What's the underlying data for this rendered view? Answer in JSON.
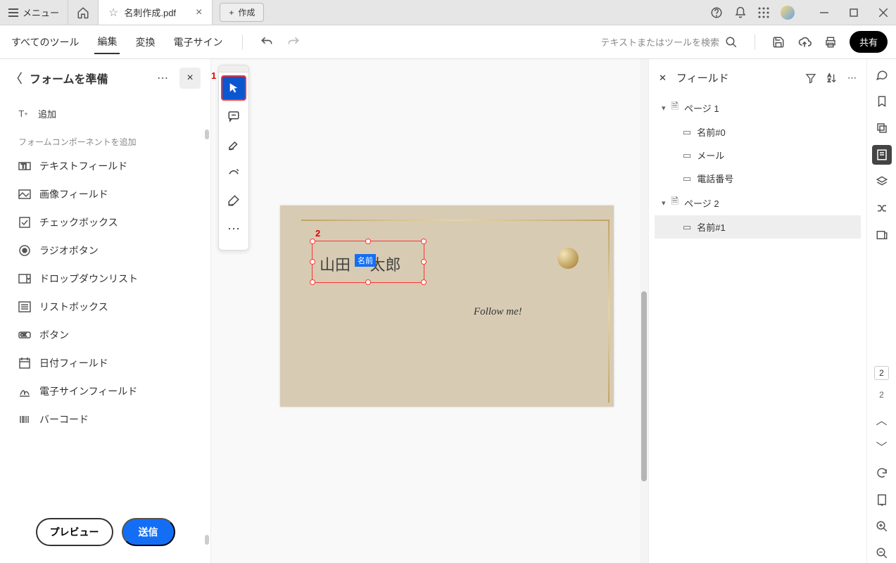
{
  "titlebar": {
    "menu_label": "メニュー",
    "tab_title": "名刺作成.pdf",
    "create_label": "作成"
  },
  "toolbar": {
    "all_tools": "すべてのツール",
    "edit": "編集",
    "convert": "変換",
    "esign": "電子サイン",
    "search_placeholder": "テキストまたはツールを検索",
    "share": "共有"
  },
  "left_panel": {
    "title": "フォームを準備",
    "add_label": "追加",
    "section_header": "フォームコンポーネントを追加",
    "items": [
      "テキストフィールド",
      "画像フィールド",
      "チェックボックス",
      "ラジオボタン",
      "ドロップダウンリスト",
      "リストボックス",
      "ボタン",
      "日付フィールド",
      "電子サインフィールド",
      "バーコード"
    ],
    "preview_btn": "プレビュー",
    "submit_btn": "送信"
  },
  "annotations": {
    "num1": "1",
    "num2": "2"
  },
  "page_content": {
    "field_text": "山田 　太郎",
    "field_label": "名前",
    "follow_text": "Follow me!"
  },
  "right_panel": {
    "title": "フィールド",
    "pages": [
      {
        "label": "ページ 1",
        "fields": [
          "名前#0",
          "メール",
          "電話番号"
        ]
      },
      {
        "label": "ページ 2",
        "fields": [
          "名前#1"
        ]
      }
    ],
    "selected_field": "名前#1"
  },
  "right_rail": {
    "page_box": "2",
    "page_total": "2"
  }
}
